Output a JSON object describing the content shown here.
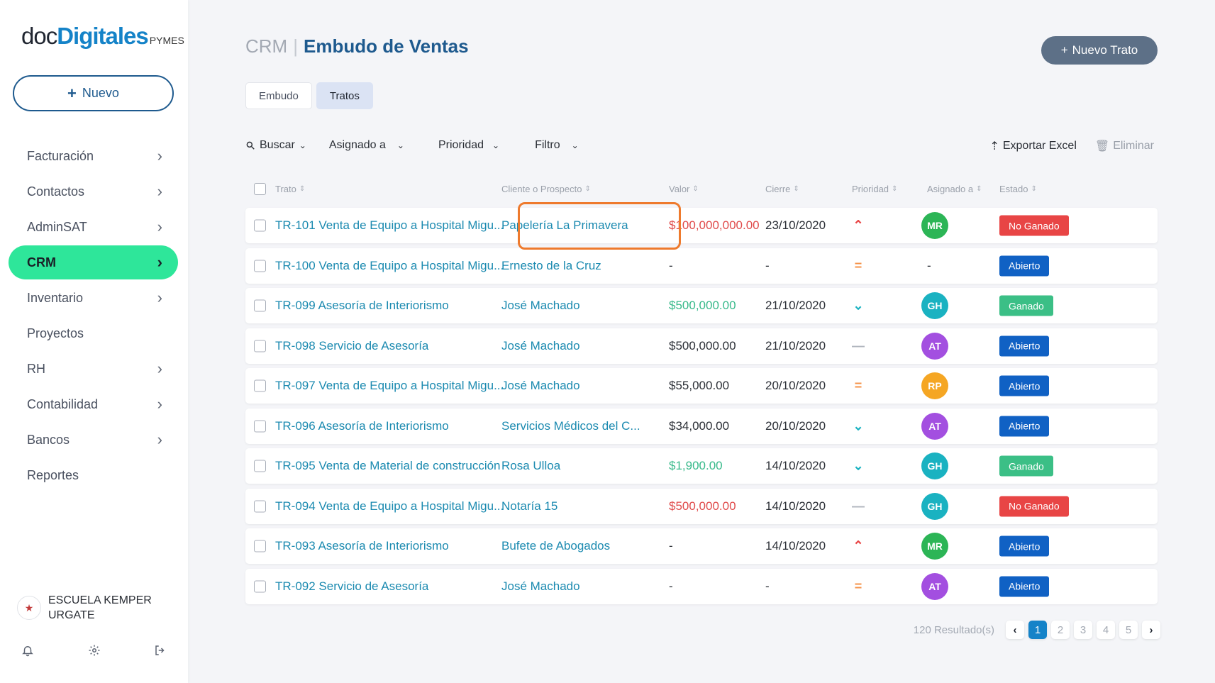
{
  "sidebar": {
    "logo": {
      "part1": "doc",
      "part2": "Digitales",
      "part3": "PYMES"
    },
    "new_button": "Nuevo",
    "items": [
      {
        "label": "Facturación",
        "has_chevron": true
      },
      {
        "label": "Contactos",
        "has_chevron": true
      },
      {
        "label": "AdminSAT",
        "has_chevron": true
      },
      {
        "label": "CRM",
        "has_chevron": true,
        "active": true
      },
      {
        "label": "Inventario",
        "has_chevron": true
      },
      {
        "label": "Proyectos",
        "has_chevron": false
      },
      {
        "label": "RH",
        "has_chevron": true
      },
      {
        "label": "Contabilidad",
        "has_chevron": true
      },
      {
        "label": "Bancos",
        "has_chevron": true
      },
      {
        "label": "Reportes",
        "has_chevron": false
      }
    ],
    "org_name": "ESCUELA KEMPER URGATE"
  },
  "header": {
    "crumb_root": "CRM",
    "separator": "|",
    "title": "Embudo de Ventas",
    "new_deal_button": "Nuevo Trato"
  },
  "tabs": [
    {
      "label": "Embudo",
      "active": false
    },
    {
      "label": "Tratos",
      "active": true
    }
  ],
  "filters": {
    "search": "Buscar",
    "assigned": "Asignado a",
    "priority": "Prioridad",
    "filter": "Filtro"
  },
  "actions": {
    "export": "Exportar Excel",
    "delete": "Eliminar"
  },
  "table": {
    "headers": {
      "deal": "Trato",
      "client": "Cliente o Prospecto",
      "value": "Valor",
      "close": "Cierre",
      "priority": "Prioridad",
      "assigned": "Asignado a",
      "state": "Estado"
    },
    "rows": [
      {
        "deal": "TR-101 Venta de Equipo a Hospital Migu...",
        "client": "Papelería La Primavera",
        "value": "$100,000,000.00",
        "value_tone": "red",
        "close": "23/10/2020",
        "priority": "alta",
        "assigned": "MR",
        "assigned_color": "#2cb556",
        "state": "No Ganado",
        "state_color": "#e84545"
      },
      {
        "deal": "TR-100 Venta de Equipo a Hospital Migu...",
        "client": "Ernesto de la Cruz",
        "value": "-",
        "value_tone": "plain",
        "close": "-",
        "priority": "media",
        "assigned": "-",
        "assigned_color": "",
        "state": "Abierto",
        "state_color": "#1061c4"
      },
      {
        "deal": "TR-099 Asesoría de Interiorismo",
        "client": "José Machado",
        "value": "$500,000.00",
        "value_tone": "green",
        "close": "21/10/2020",
        "priority": "baja",
        "assigned": "GH",
        "assigned_color": "#1ab2c1",
        "state": "Ganado",
        "state_color": "#3bbf86"
      },
      {
        "deal": "TR-098 Servicio de Asesoría",
        "client": "José Machado",
        "value": "$500,000.00",
        "value_tone": "plain",
        "close": "21/10/2020",
        "priority": "ninguna",
        "assigned": "AT",
        "assigned_color": "#a34fe0",
        "state": "Abierto",
        "state_color": "#1061c4"
      },
      {
        "deal": "TR-097 Venta de Equipo a Hospital Migu...",
        "client": "José Machado",
        "value": "$55,000.00",
        "value_tone": "plain",
        "close": "20/10/2020",
        "priority": "media",
        "assigned": "RP",
        "assigned_color": "#f5a623",
        "state": "Abierto",
        "state_color": "#1061c4"
      },
      {
        "deal": "TR-096 Asesoría de Interiorismo",
        "client": "Servicios Médicos del C...",
        "value": "$34,000.00",
        "value_tone": "plain",
        "close": "20/10/2020",
        "priority": "baja",
        "assigned": "AT",
        "assigned_color": "#a34fe0",
        "state": "Abierto",
        "state_color": "#1061c4"
      },
      {
        "deal": "TR-095 Venta de Material de construcción",
        "client": "Rosa Ulloa",
        "value": "$1,900.00",
        "value_tone": "green",
        "close": "14/10/2020",
        "priority": "baja",
        "assigned": "GH",
        "assigned_color": "#1ab2c1",
        "state": "Ganado",
        "state_color": "#3bbf86"
      },
      {
        "deal": "TR-094 Venta de Equipo a Hospital Migu...",
        "client": "Notaría 15",
        "value": "$500,000.00",
        "value_tone": "red",
        "close": "14/10/2020",
        "priority": "ninguna",
        "assigned": "GH",
        "assigned_color": "#1ab2c1",
        "state": "No Ganado",
        "state_color": "#e84545"
      },
      {
        "deal": "TR-093 Asesoría de Interiorismo",
        "client": "Bufete de Abogados",
        "value": "-",
        "value_tone": "plain",
        "close": "14/10/2020",
        "priority": "alta",
        "assigned": "MR",
        "assigned_color": "#2cb556",
        "state": "Abierto",
        "state_color": "#1061c4"
      },
      {
        "deal": "TR-092 Servicio de Asesoría",
        "client": "José Machado",
        "value": "-",
        "value_tone": "plain",
        "close": "-",
        "priority": "media",
        "assigned": "AT",
        "assigned_color": "#a34fe0",
        "state": "Abierto",
        "state_color": "#1061c4"
      }
    ]
  },
  "pagination": {
    "results": "120 Resultado(s)",
    "pages": [
      "1",
      "2",
      "3",
      "4",
      "5"
    ],
    "current": "1"
  },
  "colors": {
    "accent": "#1583c8",
    "active_nav": "#2ee69a",
    "highlight": "#ee7a2d",
    "priority_high": "#e84545",
    "priority_medium": "#f5934a",
    "priority_low": "#1ab2c1",
    "priority_none": "#b0b5bd"
  }
}
